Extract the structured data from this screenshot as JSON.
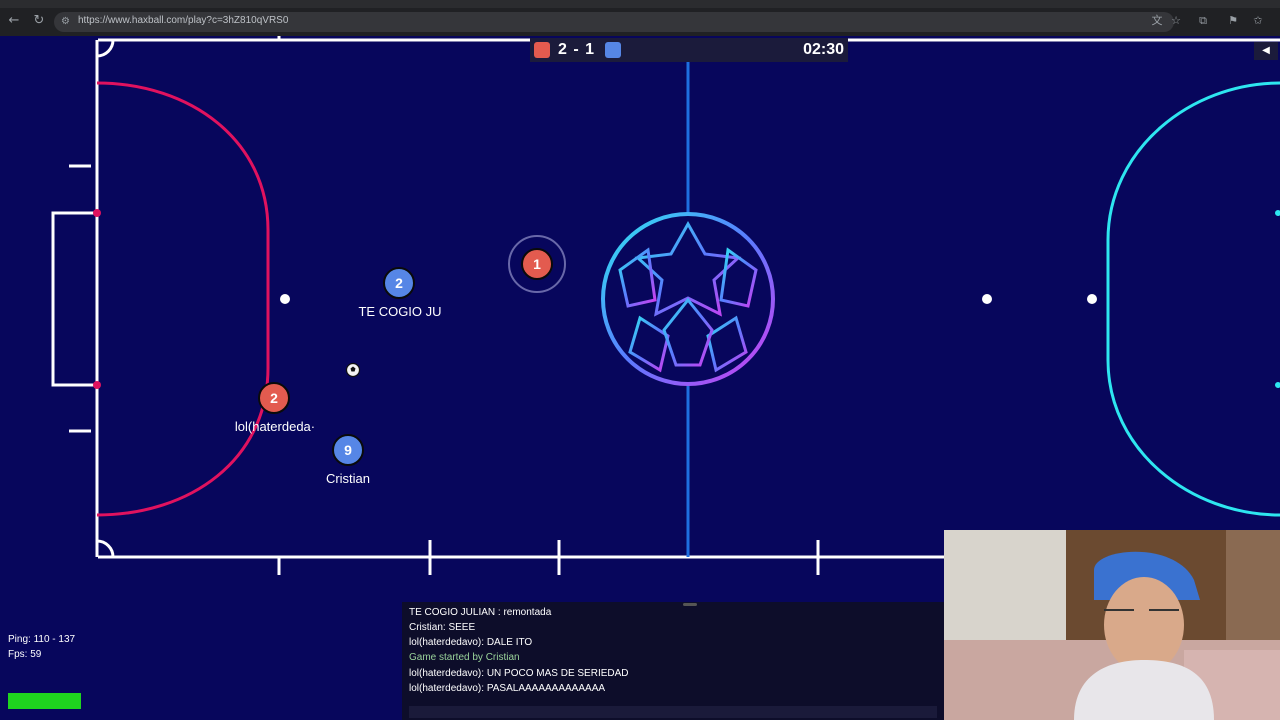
{
  "browser": {
    "url": "https://www.haxball.com/play?c=3hZ810qVRS0"
  },
  "scoreboard": {
    "score": "2 - 1",
    "clock": "02:30",
    "red_color": "#e35b4f",
    "blue_color": "#5686e6"
  },
  "field": {
    "background": "#07065c",
    "left_box_color": "#e0125f",
    "right_box_color": "#2ee6f0",
    "center_line_color": "#1e6fe0"
  },
  "players": [
    {
      "team": "red",
      "number": "1",
      "name": ""
    },
    {
      "team": "blue",
      "number": "2",
      "name": "TE COGIO JU"
    },
    {
      "team": "red",
      "number": "2",
      "name": "lol(haterdeda·"
    },
    {
      "team": "blue",
      "number": "9",
      "name": "Cristian"
    }
  ],
  "hud": {
    "ping": "Ping: 110 - 137",
    "fps": "Fps: 59"
  },
  "chat": {
    "lines": [
      {
        "text": "TE COGIO JULIAN : remontada",
        "system": false
      },
      {
        "text": "Cristian: SEEE",
        "system": false
      },
      {
        "text": "lol(haterdedavo): DALE ITO",
        "system": false
      },
      {
        "text": "Game started by Cristian",
        "system": true
      },
      {
        "text": "lol(haterdedavo): UN POCO MAS DE SERIEDAD",
        "system": false
      },
      {
        "text": "lol(haterdedavo): PASALAAAAAAAAAAAAA",
        "system": false
      }
    ]
  },
  "icons": {
    "back": "arrow-left-icon",
    "reload": "reload-icon",
    "site_info": "site-info-icon",
    "translate": "translate-icon",
    "bookmark": "star-icon",
    "extensions": "puzzle-icon",
    "favorites": "favorites-icon",
    "collapse": "collapse-triangle-icon",
    "ball": "soccer-ball-icon",
    "center_logo": "champions-ball-logo"
  }
}
